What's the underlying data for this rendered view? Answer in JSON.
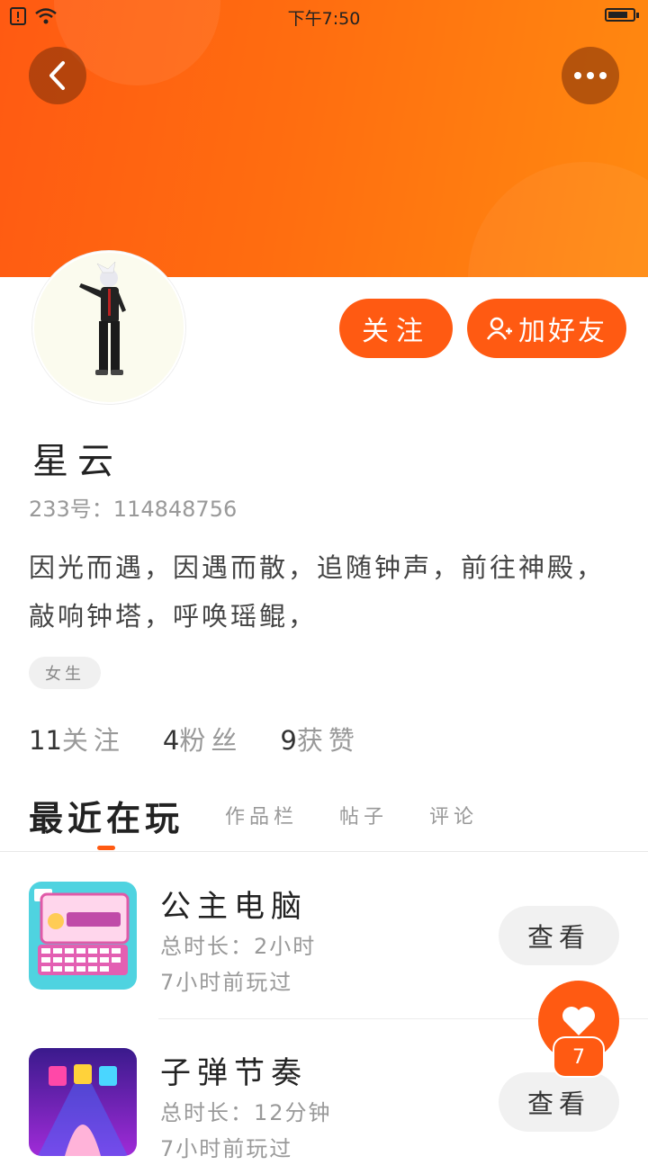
{
  "status_bar": {
    "time": "下午7:50"
  },
  "profile": {
    "name": "星云",
    "uid_label": "233号：114848756",
    "bio": "因光而遇，因遇而散，追随钟声，前往神殿，敲响钟塔，呼唤瑶鲲，",
    "gender_tag": "女生",
    "stats": [
      {
        "num": "11",
        "label": "关注"
      },
      {
        "num": "4",
        "label": "粉丝"
      },
      {
        "num": "9",
        "label": "获赞"
      }
    ]
  },
  "actions": {
    "follow_label": "关注",
    "add_friend_label": "加好友"
  },
  "tabs": {
    "active": "最近在玩",
    "others": [
      "作品栏",
      "帖子",
      "评论"
    ]
  },
  "games": [
    {
      "title": "公主电脑",
      "duration": "总时长：2小时",
      "last_played": "7小时前玩过",
      "view_label": "查看",
      "icon": "princess-computer-icon"
    },
    {
      "title": "子弹节奏",
      "duration": "总时长：12分钟",
      "last_played": "7小时前玩过",
      "view_label": "查看",
      "icon": "bullet-rhythm-icon"
    }
  ],
  "like": {
    "count": "7"
  },
  "colors": {
    "accent": "#ff5a12",
    "header_end": "#ff8a10"
  }
}
